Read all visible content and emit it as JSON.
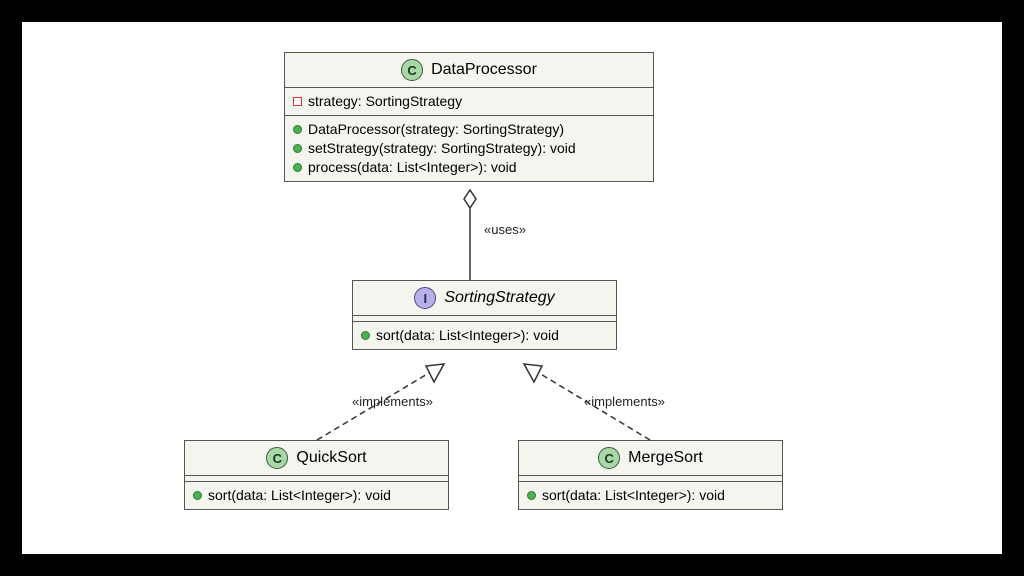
{
  "diagram": {
    "classes": {
      "dataProcessor": {
        "name": "DataProcessor",
        "stereotype": "C",
        "fields": [
          {
            "vis": "private",
            "sig": "strategy: SortingStrategy"
          }
        ],
        "methods": [
          {
            "vis": "public",
            "sig": "DataProcessor(strategy: SortingStrategy)"
          },
          {
            "vis": "public",
            "sig": "setStrategy(strategy: SortingStrategy): void"
          },
          {
            "vis": "public",
            "sig": "process(data: List<Integer>): void"
          }
        ]
      },
      "sortingStrategy": {
        "name": "SortingStrategy",
        "stereotype": "I",
        "methods": [
          {
            "vis": "public",
            "sig": "sort(data: List<Integer>): void"
          }
        ]
      },
      "quickSort": {
        "name": "QuickSort",
        "stereotype": "C",
        "methods": [
          {
            "vis": "public",
            "sig": "sort(data: List<Integer>): void"
          }
        ]
      },
      "mergeSort": {
        "name": "MergeSort",
        "stereotype": "C",
        "methods": [
          {
            "vis": "public",
            "sig": "sort(data: List<Integer>): void"
          }
        ]
      }
    },
    "relations": {
      "uses": "«uses»",
      "implements1": "«implements»",
      "implements2": "«implements»"
    }
  }
}
